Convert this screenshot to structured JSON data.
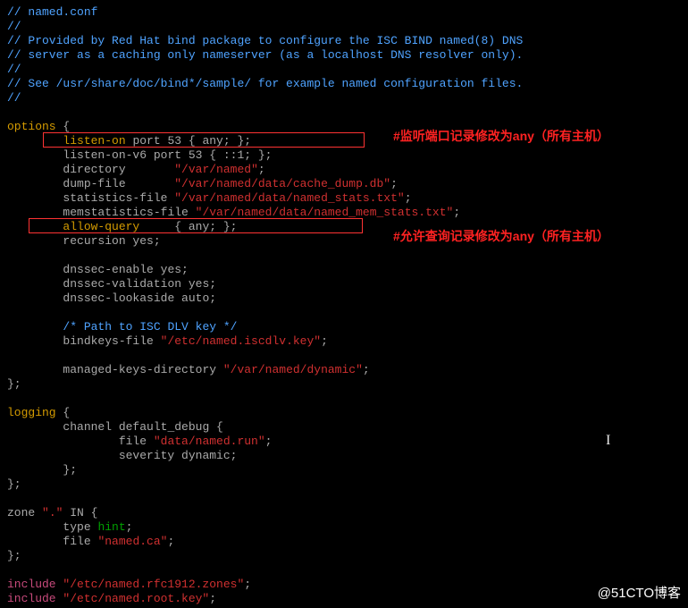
{
  "code": {
    "c1": "// named.conf",
    "c2": "//",
    "c3": "// Provided by Red Hat bind package to configure the ISC BIND named(8) DNS",
    "c4": "// server as a caching only nameserver (as a localhost DNS resolver only).",
    "c5": "//",
    "c6": "// See /usr/share/doc/bind*/sample/ for example named configuration files.",
    "c7": "//",
    "opt_open_kw": "options",
    "opt_open_brace": " {",
    "listen_kw": "listen-on",
    "listen_rest": " port 53 { any; };",
    "listen6": "listen-on-v6 port 53 { ::1; };",
    "dir_key": "directory       ",
    "dir_val": "\"/var/named\"",
    "dir_end": ";",
    "dump_key": "dump-file       ",
    "dump_val": "\"/var/named/data/cache_dump.db\"",
    "dump_end": ";",
    "stats_key": "statistics-file ",
    "stats_val": "\"/var/named/data/named_stats.txt\"",
    "stats_end": ";",
    "mstats_key": "memstatistics-file ",
    "mstats_val": "\"/var/named/data/named_mem_stats.txt\"",
    "mstats_end": ";",
    "allow_kw": "allow-query",
    "allow_rest": "     { any; };",
    "recur": "recursion yes;",
    "dnssec_en": "dnssec-enable yes;",
    "dnssec_val": "dnssec-validation yes;",
    "dnssec_la": "dnssec-lookaside auto;",
    "dlv_comment": "/* Path to ISC DLV key */",
    "bkeys_key": "bindkeys-file ",
    "bkeys_val": "\"/etc/named.iscdlv.key\"",
    "bkeys_end": ";",
    "mkd_key": "managed-keys-directory ",
    "mkd_val": "\"/var/named/dynamic\"",
    "mkd_end": ";",
    "close1": "};",
    "log_open_kw": "logging",
    "log_open_brace": " {",
    "chan_open": "channel default_debug {",
    "chan_file_key": "file ",
    "chan_file_val": "\"data/named.run\"",
    "chan_file_end": ";",
    "chan_sev": "severity dynamic;",
    "chan_close": "};",
    "close2": "};",
    "zone_open_a": "zone ",
    "zone_open_b": "\".\"",
    "zone_open_c": " IN {",
    "zone_type_a": "type ",
    "zone_type_b": "hint",
    "zone_type_c": ";",
    "zone_file_a": "file ",
    "zone_file_b": "\"named.ca\"",
    "zone_file_c": ";",
    "close3": "};",
    "inc1_a": "include",
    "inc1_b": " \"/etc/named.rfc1912.zones\"",
    "inc1_c": ";",
    "inc2_a": "include",
    "inc2_b": " \"/etc/named.root.key\"",
    "inc2_c": ";"
  },
  "annot": {
    "a1": "#监听端口记录修改为any（所有主机）",
    "a2": "#允许查询记录修改为any（所有主机）"
  },
  "watermark": "@51CTO博客",
  "cursor_glyph": "I"
}
